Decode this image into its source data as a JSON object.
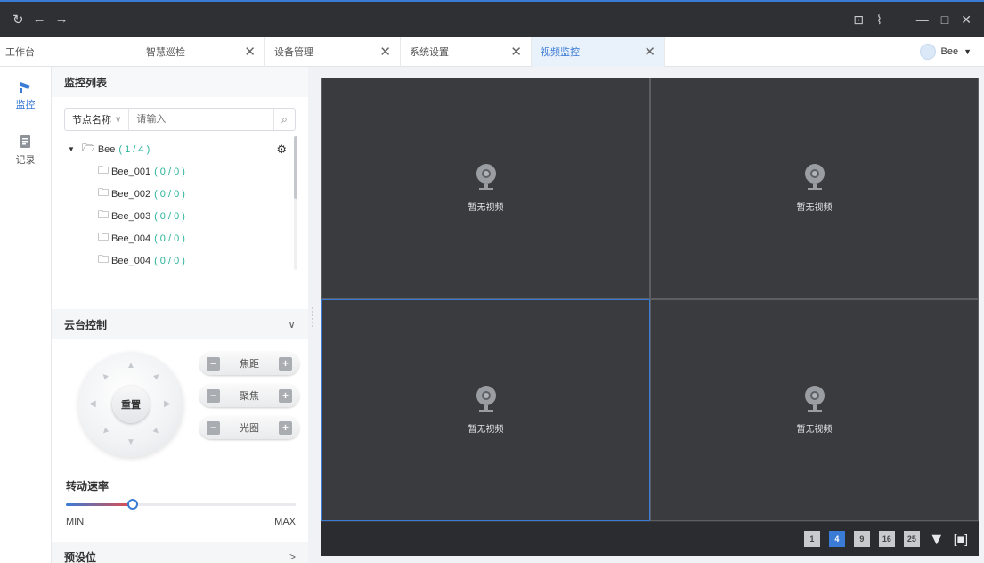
{
  "titlebar": {
    "refresh_icon": "refresh-icon",
    "back_icon": "arrow-left-icon",
    "forward_icon": "arrow-right-icon",
    "lock_icon": "lock-icon",
    "chart_icon": "chart-icon",
    "minimize_glyph": "—",
    "maximize_glyph": "□",
    "close_glyph": "✕"
  },
  "tabs": {
    "home": "工作台",
    "items": [
      {
        "label": "智慧巡检",
        "close": "✕"
      },
      {
        "label": "设备管理",
        "close": "✕"
      },
      {
        "label": "系统设置",
        "close": "✕"
      },
      {
        "label": "视频监控",
        "close": "✕"
      }
    ],
    "user": {
      "name": "Bee",
      "caret": "▼"
    }
  },
  "rail": {
    "items": [
      {
        "label": "监控",
        "icon": "camera-icon"
      },
      {
        "label": "记录",
        "icon": "document-icon"
      }
    ]
  },
  "monitor_list": {
    "title": "监控列表",
    "search": {
      "field": "节点名称",
      "chevron": "∨",
      "placeholder": "请输入",
      "icon": "search-icon"
    },
    "root": {
      "name": "Bee",
      "count": "( 1 / 4 )"
    },
    "children": [
      {
        "name": "Bee_001",
        "count": "( 0 / 0 )"
      },
      {
        "name": "Bee_002",
        "count": "( 0 / 0 )"
      },
      {
        "name": "Bee_003",
        "count": "( 0 / 0 )"
      },
      {
        "name": "Bee_004",
        "count": "( 0 / 0 )"
      },
      {
        "name": "Bee_004",
        "count": "( 0 / 0 )"
      }
    ]
  },
  "ptz": {
    "title": "云台控制",
    "chevron": "∨",
    "reset": "重置",
    "controls": [
      {
        "label": "焦距",
        "minus": "−",
        "plus": "+"
      },
      {
        "label": "聚焦",
        "minus": "−",
        "plus": "+"
      },
      {
        "label": "光圈",
        "minus": "−",
        "plus": "+"
      }
    ],
    "speed_label": "转动速率",
    "speed_value": 0.29,
    "min_label": "MIN",
    "max_label": "MAX"
  },
  "preset": {
    "title": "预设位",
    "chevron": ">"
  },
  "video": {
    "cells": [
      {
        "text": "暂无视频"
      },
      {
        "text": "暂无视频"
      },
      {
        "text": "暂无视频"
      },
      {
        "text": "暂无视频"
      }
    ],
    "layouts": [
      {
        "label": "1",
        "active": false
      },
      {
        "label": "4",
        "active": true
      },
      {
        "label": "9",
        "active": false
      },
      {
        "label": "16",
        "active": false
      },
      {
        "label": "25",
        "active": false
      }
    ],
    "more_glyph": "▼",
    "fullscreen_glyph": "[■]"
  }
}
